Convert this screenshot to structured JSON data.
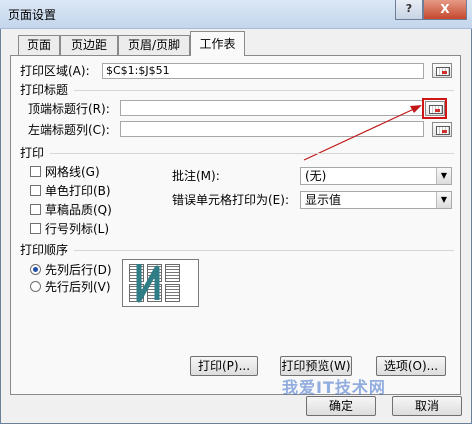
{
  "window": {
    "title": "页面设置",
    "help_label": "?",
    "close_label": "X"
  },
  "tabs": [
    {
      "label": "页面"
    },
    {
      "label": "页边距"
    },
    {
      "label": "页眉/页脚"
    },
    {
      "label": "工作表"
    }
  ],
  "print_area": {
    "label": "打印区域(A):",
    "value": "$C$1:$J$51"
  },
  "print_titles": {
    "section": "打印标题",
    "top_rows_label": "顶端标题行(R):",
    "top_rows_value": "",
    "left_cols_label": "左端标题列(C):",
    "left_cols_value": ""
  },
  "print": {
    "section": "打印",
    "checkboxes": [
      {
        "label": "网格线(G)",
        "checked": false
      },
      {
        "label": "单色打印(B)",
        "checked": false
      },
      {
        "label": "草稿品质(Q)",
        "checked": false
      },
      {
        "label": "行号列标(L)",
        "checked": false
      }
    ],
    "comments_label": "批注(M):",
    "comments_value": "(无)",
    "errors_label": "错误单元格打印为(E):",
    "errors_value": "显示值"
  },
  "order": {
    "section": "打印顺序",
    "options": [
      {
        "label": "先列后行(D)",
        "selected": true
      },
      {
        "label": "先行后列(V)",
        "selected": false
      }
    ]
  },
  "buttons": {
    "print": "打印(P)...",
    "preview": "打印预览(W)",
    "options": "选项(O)...",
    "ok": "确定",
    "cancel": "取消"
  },
  "watermark": "我爱IT技术网",
  "colors": {
    "annotation": "#d01515",
    "accent": "#1f4fa8"
  }
}
